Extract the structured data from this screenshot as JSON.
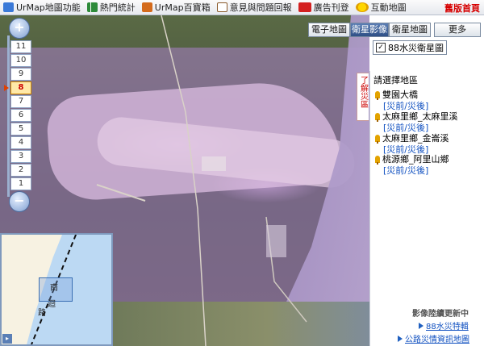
{
  "toolbar": {
    "items": [
      {
        "label": "UrMap地圖功能",
        "icon": "map-app-icon",
        "color": "#3b7ad8"
      },
      {
        "label": "熱門統計",
        "icon": "bar-chart-icon",
        "color": "#2e8b3a"
      },
      {
        "label": "UrMap百寶箱",
        "icon": "toolbox-icon",
        "color": "#d46b1c"
      },
      {
        "label": "意見與問題回報",
        "icon": "feedback-icon",
        "color": "#8a5a2b"
      },
      {
        "label": "廣告刊登",
        "icon": "ad-icon",
        "color": "#d42020"
      },
      {
        "label": "互動地圖",
        "icon": "interactive-map-icon",
        "color": "#e0b000"
      }
    ],
    "old_version": "舊版首頁"
  },
  "map_tabs": {
    "electronic": "電子地圖",
    "satellite": "衛星影像",
    "satellite_map": "衛星地圖",
    "more": "更多"
  },
  "layer": {
    "label": "88水災衛星圖",
    "checked_mark": "✓"
  },
  "zoom": {
    "in": "+",
    "out": "−",
    "levels": [
      "11",
      "10",
      "9",
      "8",
      "7",
      "6",
      "5",
      "4",
      "3",
      "2",
      "1"
    ],
    "selected": "8"
  },
  "minimap": {
    "labels": [
      "南",
      "迴",
      "路"
    ],
    "toggle": "▸"
  },
  "panel": {
    "tab_label": "了解災區",
    "title": "請選擇地區",
    "places": [
      {
        "name": "雙園大橋",
        "links": "[災前/災後]"
      },
      {
        "name": "太麻里鄉_太麻里溪",
        "links": "[災前/災後]"
      },
      {
        "name": "太麻里鄉_金崙溪",
        "links": "[災前/災後]"
      },
      {
        "name": "桃源鄉_阿里山鄉",
        "links": "[災前/災後]"
      }
    ],
    "update_note": "影像陸續更新中",
    "link1": "88水災特輯",
    "link2": "公路災情資訊地圖"
  },
  "colors": {
    "accent": "#2f4f86",
    "link": "#1050c0",
    "alert": "#d60000"
  }
}
